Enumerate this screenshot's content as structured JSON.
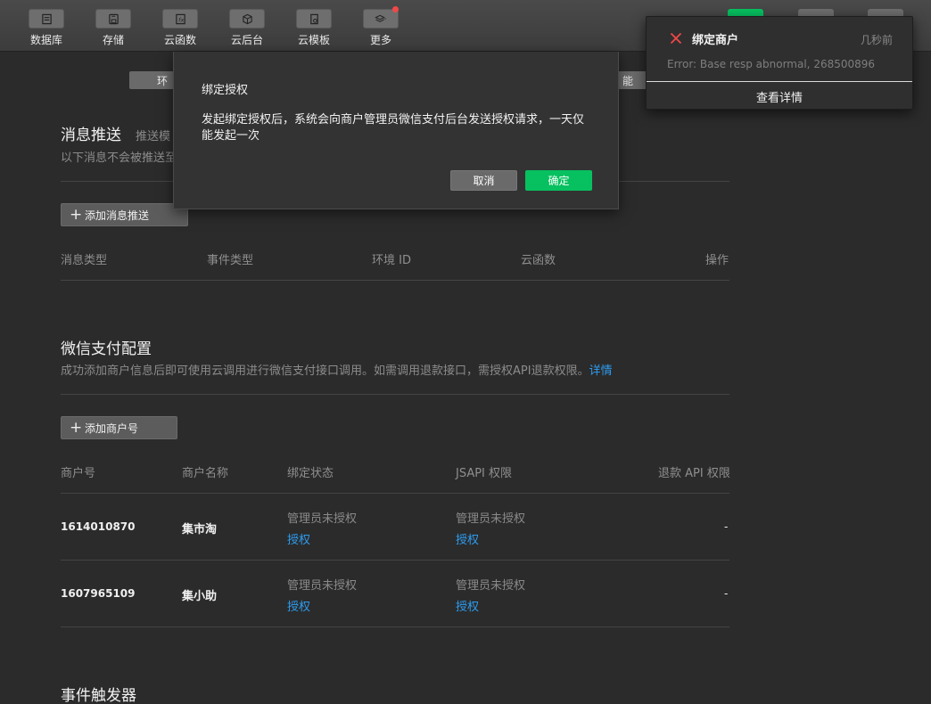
{
  "toolbar": {
    "items": [
      {
        "label": "数据库",
        "icon": "database-icon"
      },
      {
        "label": "存储",
        "icon": "storage-icon"
      },
      {
        "label": "云函数",
        "icon": "cloud-function-icon"
      },
      {
        "label": "云后台",
        "icon": "cloud-backend-icon"
      },
      {
        "label": "云模板",
        "icon": "cloud-template-icon"
      },
      {
        "label": "更多",
        "icon": "layers-icon"
      }
    ]
  },
  "env_tabs": [
    "环",
    "能"
  ],
  "message_push": {
    "title": "消息推送",
    "subtitle_tail": "推送模",
    "desc": "以下消息不会被推送至",
    "add_button": "添加消息推送",
    "columns": [
      "消息类型",
      "事件类型",
      "环境 ID",
      "云函数",
      "操作"
    ]
  },
  "wechat_pay": {
    "title": "微信支付配置",
    "desc": "成功添加商户信息后即可使用云调用进行微信支付接口调用。如需调用退款接口，需授权API退款权限。",
    "desc_link": "详情",
    "add_button": "添加商户号",
    "columns": [
      "商户号",
      "商户名称",
      "绑定状态",
      "JSAPI 权限",
      "退款 API 权限"
    ],
    "rows": [
      {
        "id": "1614010870",
        "name": "集市淘",
        "bind_status": "管理员未授权",
        "bind_action": "授权",
        "jsapi_status": "管理员未授权",
        "jsapi_action": "授权",
        "refund": "-"
      },
      {
        "id": "1607965109",
        "name": "集小助",
        "bind_status": "管理员未授权",
        "bind_action": "授权",
        "jsapi_status": "管理员未授权",
        "jsapi_action": "授权",
        "refund": "-"
      }
    ]
  },
  "event_trigger": {
    "title": "事件触发器"
  },
  "modal": {
    "title": "绑定授权",
    "body": "发起绑定授权后，系统会向商户管理员微信支付后台发送授权请求，一天仅能发起一次",
    "cancel": "取消",
    "confirm": "确定"
  },
  "toast": {
    "title": "绑定商户",
    "time": "几秒前",
    "message": "Error: Base resp abnormal, 268500896",
    "link": "查看详情"
  },
  "colors": {
    "accent_green": "#07c160",
    "link_blue": "#2d9cf0",
    "error_red": "#f04848"
  }
}
